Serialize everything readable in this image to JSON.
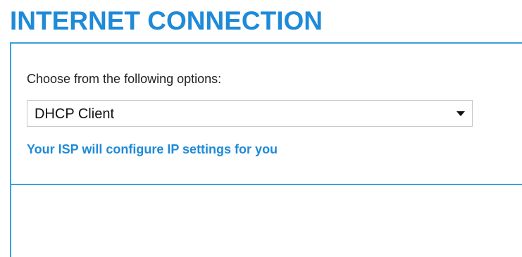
{
  "header": {
    "title": "INTERNET CONNECTION"
  },
  "connection": {
    "options_label": "Choose from the following options:",
    "selected_option": "DHCP Client",
    "info_text": "Your ISP will configure IP settings for you"
  },
  "colors": {
    "accent": "#1f8ad8",
    "border": "#3aa0e0"
  },
  "icons": {
    "dropdown": "chevron-down-icon"
  }
}
